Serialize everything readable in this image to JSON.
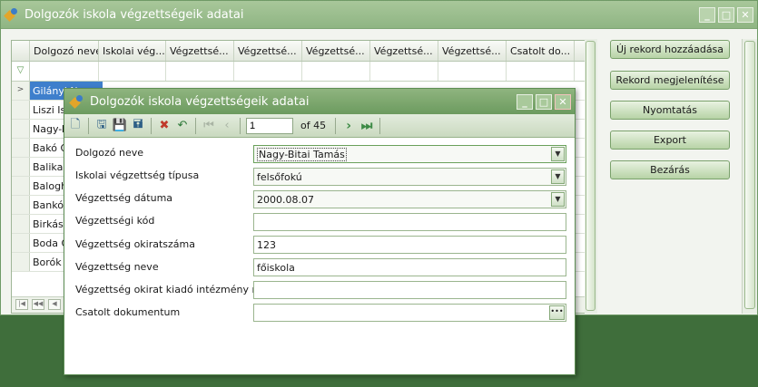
{
  "main": {
    "title": "Dolgozók iskola végzettségeik adatai",
    "grid": {
      "columns": [
        "Dolgozó neve",
        "Iskolai vég...",
        "Végzettsé...",
        "Végzettsé...",
        "Végzettsé...",
        "Végzettsé...",
        "Végzettsé...",
        "Csatolt do..."
      ],
      "rows": [
        "Gilányi N",
        "Liszi Istv",
        "Nagy-Bi",
        "Bakó Gy",
        "Balika Is",
        "Balogh S",
        "Bankó G",
        "Birkás A",
        "Boda Gy",
        "Borók Is"
      ]
    },
    "buttons": {
      "add": "Új rekord hozzáadása",
      "show": "Rekord megjelenítése",
      "print": "Nyomtatás",
      "export": "Export",
      "close": "Bezárás"
    }
  },
  "dialog": {
    "title": "Dolgozók iskola végzettségeik adatai",
    "navigator": {
      "position": "1",
      "of_label": "of 45"
    },
    "fields": {
      "employee": {
        "label": "Dolgozó neve",
        "value": "Nagy-Bitai Tamás"
      },
      "edu_type": {
        "label": "Iskolai végzettség típusa",
        "value": "felsőfokú"
      },
      "edu_date": {
        "label": "Végzettség dátuma",
        "value": "2000.08.07"
      },
      "edu_code": {
        "label": "Végzettségi kód",
        "value": ""
      },
      "cert_no": {
        "label": "Végzettség okiratszáma",
        "value": "123"
      },
      "edu_name": {
        "label": "Végzettség neve",
        "value": "főiskola"
      },
      "issuer": {
        "label": "Végzettség okirat kiadó intézmény neve",
        "value": ""
      },
      "attachment": {
        "label": "Csatolt dokumentum",
        "value": ""
      }
    }
  }
}
